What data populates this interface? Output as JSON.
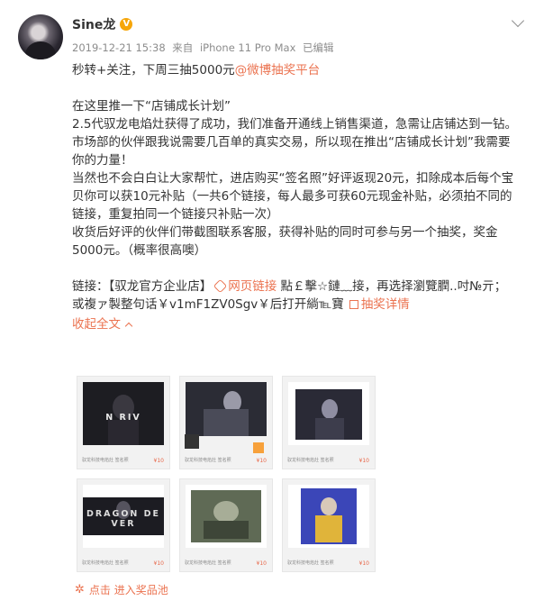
{
  "post": {
    "user_name": "Sine龙",
    "verified_badge": "V",
    "timestamp": "2019-12-21 15:38",
    "source_prefix": "来自",
    "device": "iPhone 11 Pro Max",
    "edited": "已编辑",
    "line1_prefix": "秒转+关注，下周三抽5000元",
    "line1_link": "@微博抽奖平台",
    "para_intro": "在这里推一下“店铺成长计划”",
    "para_2": "2.5代驭龙电焰灶获得了成功，我们准备开通线上销售渠道，急需让店铺达到一钻。市场部的伙伴跟我说需要几百单的真实交易，所以现在推出“店铺成长计划”我需要你的力量！",
    "para_3": "当然也不会白白让大家帮忙，进店购买“签名照”好评返现20元，扣除成本后每个宝贝你可以获10元补贴（一共6个链接，每人最多可获60元现金补贴，必须拍不同的链接，重复拍同一个链接只补贴一次）",
    "para_4": "收货后好评的伙伴们带截图联系客服，获得补贴的同时可参与另一个抽奖，奖金5000元。（概率很高噢）",
    "link_prefix": "链接：【驭龙官方企业店】",
    "link_web": "网页链接",
    "link_garble": " 點￡擊☆鏈﹏接，再选择瀏覽膶..吋№亓；或複ァ製整句话￥v1mF1ZV0Sgv￥后打开",
    "link_garble_2": "緔℡寶",
    "lottery_details": "抽奖详情",
    "collapse_label": "收起全文",
    "prize_pool": "点击 进入奖品池"
  },
  "thumbnails": [
    {
      "watermark": "N RIV",
      "price": "¥10",
      "tag": "驭龙科技电焰灶 签名照"
    },
    {
      "watermark": "",
      "price": "¥10",
      "tag": "驭龙科技电焰灶 签名照"
    },
    {
      "watermark": "",
      "price": "¥10",
      "tag": "驭龙科技电焰灶 签名照"
    },
    {
      "watermark": "DRAGON DE  VER",
      "price": "¥10",
      "tag": "驭龙科技电焰灶 签名照"
    },
    {
      "watermark": "",
      "price": "¥10",
      "tag": "驭龙科技电焰灶 签名照"
    },
    {
      "watermark": "",
      "price": "¥10",
      "tag": "驭龙科技电焰灶 签名照"
    }
  ],
  "colors": {
    "accent": "#eb7350",
    "verified": "#f6a609",
    "meta_gray": "#8c8c8c",
    "text": "#333333"
  }
}
